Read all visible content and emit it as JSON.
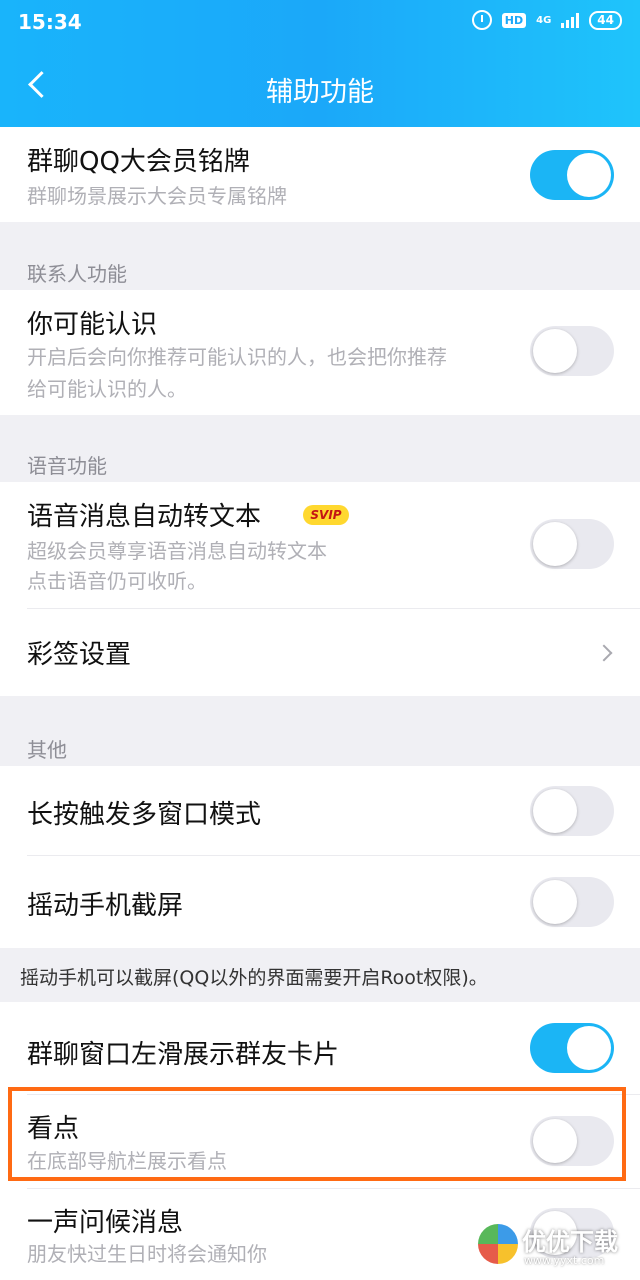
{
  "status_bar": {
    "time": "15:34",
    "hd": "HD",
    "network": "4G",
    "battery": "44"
  },
  "header": {
    "title": "辅助功能"
  },
  "items": {
    "qq_badge": {
      "title": "群聊QQ大会员铭牌",
      "desc": "群聊场景展示大会员专属铭牌",
      "on": true
    },
    "may_know": {
      "title": "你可能认识",
      "desc_line1": "开启后会向你推荐可能认识的人，也会把你推荐",
      "desc_line2": "给可能认识的人。",
      "on": false
    },
    "voice_to_text": {
      "title": "语音消息自动转文本",
      "badge": "SVIP",
      "desc_line1": "超级会员尊享语音消息自动转文本",
      "desc_line2": "点击语音仍可收听。",
      "on": false
    },
    "color_tag": {
      "title": "彩签设置"
    },
    "long_press_multiwindow": {
      "title": "长按触发多窗口模式",
      "on": false
    },
    "shake_screenshot": {
      "title": "摇动手机截屏",
      "on": false
    },
    "swipe_group_card": {
      "title": "群聊窗口左滑展示群友卡片",
      "on": true
    },
    "kandian": {
      "title": "看点",
      "desc": "在底部导航栏展示看点",
      "on": false
    },
    "greeting": {
      "title": "一声问候消息",
      "desc": "朋友快过生日时将会通知你",
      "on": false
    }
  },
  "sections": {
    "contacts": "联系人功能",
    "voice": "语音功能",
    "other": "其他"
  },
  "shake_hint": "摇动手机可以截屏(QQ以外的界面需要开启Root权限)。",
  "watermark": {
    "title": "优优下载",
    "url": "www.yyxt.com"
  },
  "colors": {
    "header_blue": "#1ba8f9",
    "toggle_on": "#1bb5f5",
    "highlight": "#ff6a13"
  }
}
